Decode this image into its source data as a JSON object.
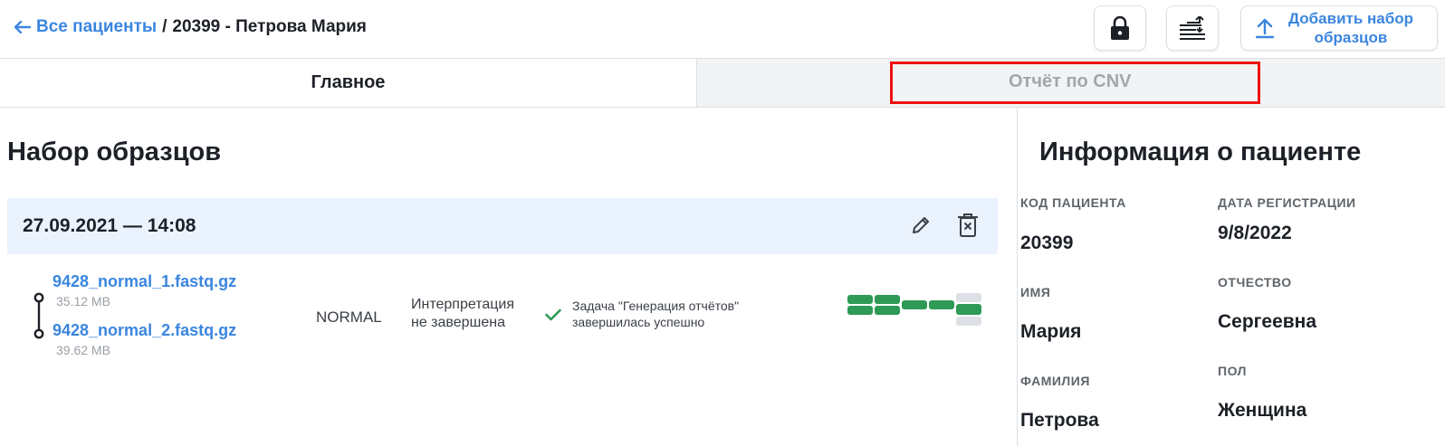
{
  "breadcrumb": {
    "back_label": "Все пациенты",
    "separator": "/",
    "current": "20399 - Петрова Мария"
  },
  "toolbar": {
    "lock_icon": "lock-icon",
    "swap_icon": "swap-list-icon",
    "add_label": "Добавить набор образцов",
    "add_icon": "upload-icon"
  },
  "tabs": [
    {
      "label": "Главное",
      "active": true
    },
    {
      "label": "Отчёт по CNV",
      "active": false
    }
  ],
  "samples_section": {
    "title": "Набор образцов",
    "sets": [
      {
        "datetime": "27.09.2021 — 14:08",
        "files": [
          {
            "name": "9428_normal_1.fastq.gz",
            "size": "35.12 MB"
          },
          {
            "name": "9428_normal_2.fastq.gz",
            "size": "39.62 MB"
          }
        ],
        "sample_type": "NORMAL",
        "interpretation": [
          "Интерпретация",
          "не завершена"
        ],
        "task_status": [
          "Задача \"Генерация отчётов\"",
          "завершилась успешно"
        ],
        "pipeline_status": {
          "green": "#2e9a55",
          "grey": "#dde0e4",
          "steps_completed": 5,
          "steps_total": 6
        }
      }
    ]
  },
  "patient_info": {
    "title": "Информация о пациенте",
    "fields": [
      {
        "label": "КОД ПАЦИЕНТА",
        "value": "20399"
      },
      {
        "label": "ДАТА РЕГИСТРАЦИИ",
        "value": "9/8/2022"
      },
      {
        "label": "ИМЯ",
        "value": "Мария"
      },
      {
        "label": "ОТЧЕСТВО",
        "value": "Сергеевна"
      },
      {
        "label": "ФАМИЛИЯ",
        "value": "Петрова"
      },
      {
        "label": "ПОЛ",
        "value": "Женщина"
      }
    ]
  },
  "colors": {
    "accent": "#3b86df",
    "highlight": "#ee1111",
    "set_header_bg": "#eaf2fd",
    "success": "#2e9a55"
  }
}
